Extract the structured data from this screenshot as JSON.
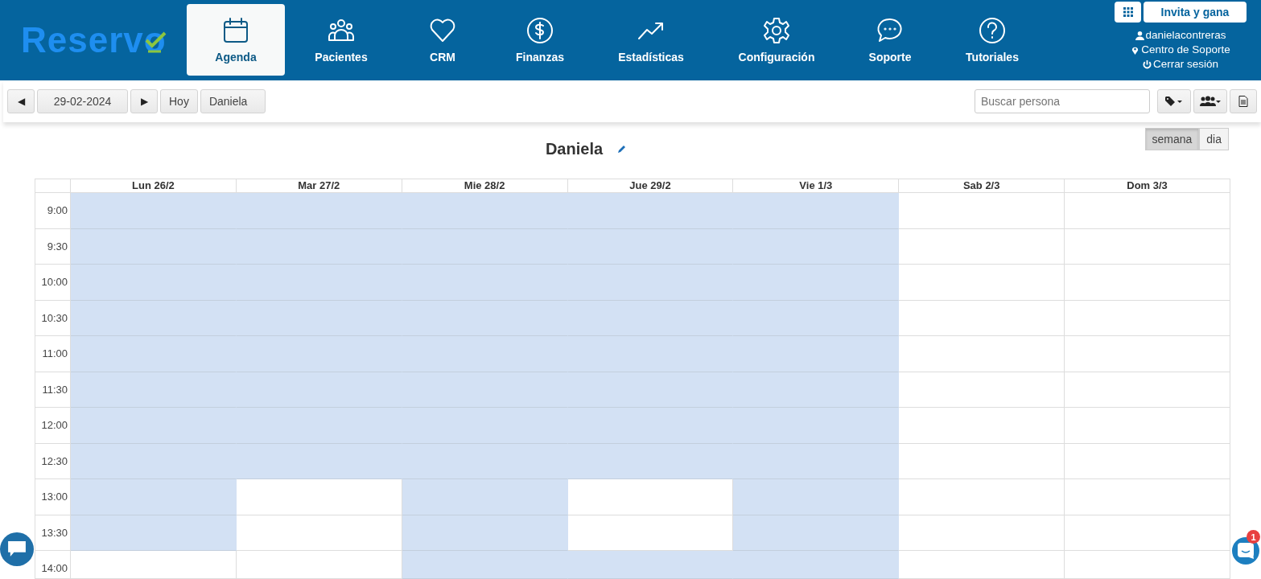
{
  "logo": "Reservo",
  "nav": [
    {
      "label": "Agenda",
      "selected": true
    },
    {
      "label": "Pacientes",
      "selected": false
    },
    {
      "label": "CRM",
      "selected": false
    },
    {
      "label": "Finanzas",
      "selected": false
    },
    {
      "label": "Estadísticas",
      "selected": false
    },
    {
      "label": "Configuración",
      "selected": false
    },
    {
      "label": "Soporte",
      "selected": false
    },
    {
      "label": "Tutoriales",
      "selected": false
    }
  ],
  "invite_button": "Invita y gana",
  "user_links": [
    "danielacontreras",
    "Centro de Soporte",
    "Cerrar sesión"
  ],
  "toolbar": {
    "prev": "◀",
    "date": "29-02-2024",
    "next": "▶",
    "today": "Hoy",
    "professional": "Daniela",
    "search": {
      "placeholder": "Buscar persona"
    }
  },
  "calendar_title": "Daniela",
  "views": [
    {
      "label": "semana",
      "selected": true
    },
    {
      "label": "dia",
      "selected": false
    }
  ],
  "days": [
    "Lun 26/2",
    "Mar 27/2",
    "Mie 28/2",
    "Jue 29/2",
    "Vie 1/3",
    "Sab 2/3",
    "Dom 3/3"
  ],
  "rows": [
    {
      "time": "9:00",
      "available": [
        true,
        true,
        true,
        true,
        true,
        false,
        false
      ]
    },
    {
      "time": "9:30",
      "available": [
        true,
        true,
        true,
        true,
        true,
        false,
        false
      ]
    },
    {
      "time": "10:00",
      "available": [
        true,
        true,
        true,
        true,
        true,
        false,
        false
      ]
    },
    {
      "time": "10:30",
      "available": [
        true,
        true,
        true,
        true,
        true,
        false,
        false
      ]
    },
    {
      "time": "11:00",
      "available": [
        true,
        true,
        true,
        true,
        true,
        false,
        false
      ]
    },
    {
      "time": "11:30",
      "available": [
        true,
        true,
        true,
        true,
        true,
        false,
        false
      ]
    },
    {
      "time": "12:00",
      "available": [
        true,
        true,
        true,
        true,
        true,
        false,
        false
      ]
    },
    {
      "time": "12:30",
      "available": [
        true,
        true,
        true,
        true,
        true,
        false,
        false
      ]
    },
    {
      "time": "13:00",
      "available": [
        true,
        false,
        true,
        false,
        true,
        false,
        false
      ]
    },
    {
      "time": "13:30",
      "available": [
        true,
        false,
        true,
        false,
        true,
        false,
        false
      ]
    },
    {
      "time": "14:00",
      "available": [
        false,
        false,
        true,
        true,
        true,
        false,
        false
      ]
    }
  ],
  "notifications": "1"
}
